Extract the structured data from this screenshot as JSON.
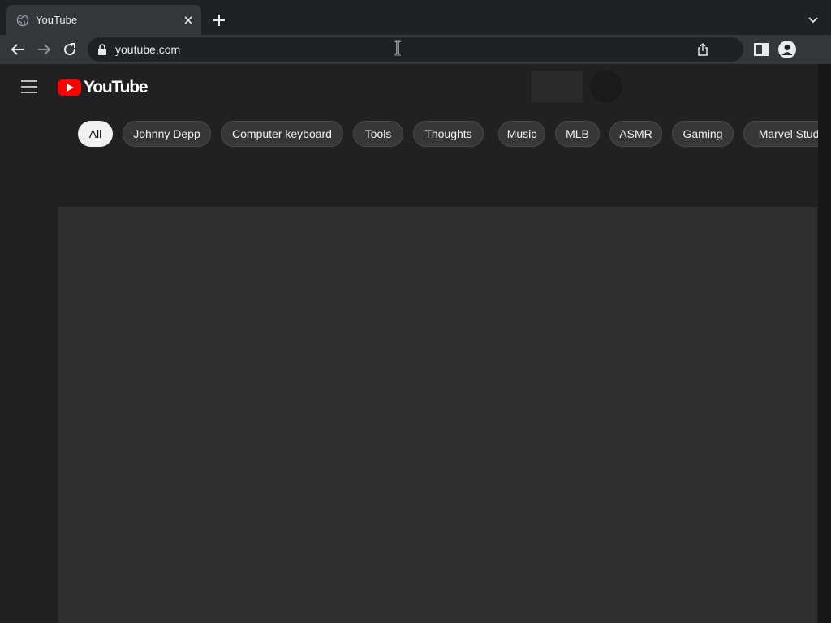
{
  "browser": {
    "tab": {
      "title": "YouTube"
    },
    "omnibox": {
      "url": "youtube.com"
    }
  },
  "youtube": {
    "logo_text": "YouTube",
    "chips": [
      {
        "label": "All",
        "selected": true
      },
      {
        "label": "Johnny Depp"
      },
      {
        "label": "Computer keyboard"
      },
      {
        "label": "Tools"
      },
      {
        "label": "Thoughts"
      },
      {
        "label": "Music"
      },
      {
        "label": "MLB"
      },
      {
        "label": "ASMR"
      },
      {
        "label": "Gaming"
      },
      {
        "label": "Marvel Studios"
      }
    ]
  },
  "colors": {
    "page_background": "#212121",
    "chip_background": "#373737",
    "chip_selected": "#f1f1f1",
    "brand_red": "#ff0000"
  }
}
